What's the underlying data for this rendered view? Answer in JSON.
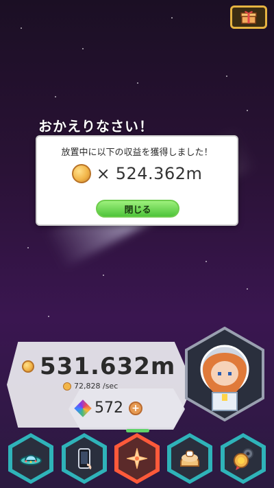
{
  "overlay": {
    "title": "おかえりなさい！",
    "message": "放置中に以下の収益を獲得しました！",
    "reward_multiplier": "×",
    "reward_amount": "524.362m",
    "close_label": "閉じる"
  },
  "status": {
    "gold_amount": "531.632m",
    "gold_rate": "72,828 /sec",
    "gems": "572"
  },
  "bottom_nav": {
    "items": [
      {
        "icon": "ufo-icon"
      },
      {
        "icon": "phone-icon"
      },
      {
        "icon": "compass-star-icon",
        "active": true
      },
      {
        "icon": "bread-icon"
      },
      {
        "icon": "medal-gear-icon"
      }
    ]
  },
  "top_right": {
    "icon": "gift-icon"
  },
  "colors": {
    "accent_green": "#6ecc4d",
    "coin_gold": "#f2b64a",
    "nav_teal": "#2fb3b9",
    "nav_active": "#ff5a3a"
  }
}
